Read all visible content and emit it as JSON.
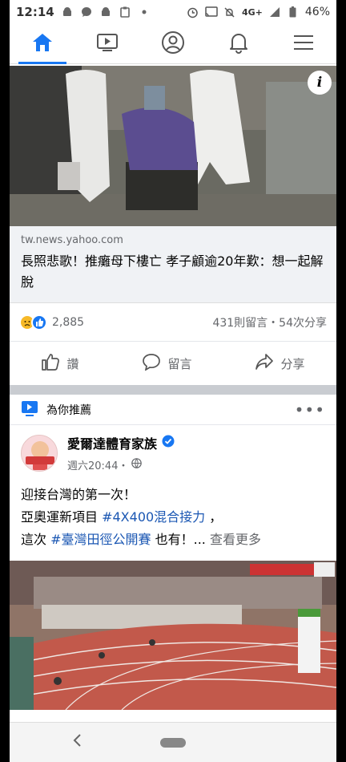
{
  "status_bar": {
    "time": "12:14",
    "network": "4G+",
    "battery": "46%"
  },
  "nav": {
    "items": [
      "home-icon",
      "video-icon",
      "profile-icon",
      "bell-icon",
      "menu-icon"
    ],
    "active_color": "#1877f2"
  },
  "post1": {
    "link_domain": "tw.news.yahoo.com",
    "link_title": "長照悲歌！推癱母下樓亡 孝子顧逾20年歎：想一起解脫",
    "reaction_count": "2,885",
    "comments_shares": "431則留言・54次分享",
    "like_label": "讚",
    "comment_label": "留言",
    "share_label": "分享"
  },
  "recommended": {
    "header_label": "為你推薦"
  },
  "post2": {
    "page_name": "愛爾達體育家族",
    "time": "週六20:44・",
    "line1": "迎接台灣的第一次！",
    "line2_pre": "亞奧運新項目 ",
    "hashtag1": "#4X400混合接力",
    "line2_post": " ，",
    "line3_pre": "這次 ",
    "hashtag2": "#臺灣田徑公開賽",
    "line3_post": " 也有！... ",
    "see_more": "查看更多"
  },
  "colors": {
    "brand_blue": "#1877f2",
    "hashtag": "#1b57b3",
    "secondary_text": "#65676b"
  }
}
